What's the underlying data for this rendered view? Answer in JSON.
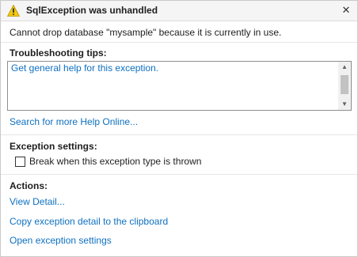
{
  "dialog": {
    "title": "SqlException was unhandled",
    "message": "Cannot drop database \"mysample\" because it is currently in use.",
    "icons": {
      "warning": "warning-icon",
      "close": "close-icon"
    },
    "close_glyph": "✕"
  },
  "troubleshooting": {
    "heading": "Troubleshooting tips:",
    "tips": [
      "Get general help for this exception."
    ],
    "search_link": "Search for more Help Online..."
  },
  "exception_settings": {
    "heading": "Exception settings:",
    "checkbox_label": "Break when this exception type is thrown",
    "checked": false
  },
  "actions": {
    "heading": "Actions:",
    "items": [
      "View Detail...",
      "Copy exception detail to the clipboard",
      "Open exception settings"
    ]
  },
  "colors": {
    "link": "#0e70c0",
    "warning": "#f2c80f"
  }
}
